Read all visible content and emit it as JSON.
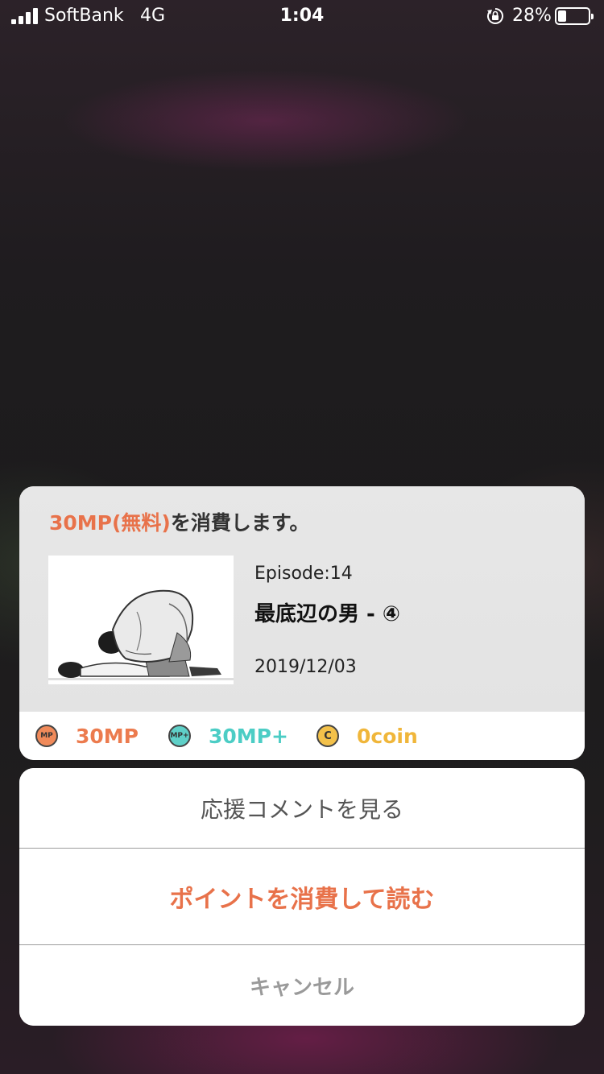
{
  "status_bar": {
    "carrier": "SoftBank",
    "network": "4G",
    "time": "1:04",
    "battery_percent": "28%",
    "battery_level": 0.28,
    "icons": [
      "signal-icon",
      "rotation-lock-icon",
      "battery-icon"
    ]
  },
  "dialog": {
    "consume_amount": "30MP(無料)",
    "consume_suffix": "を消費します。",
    "episode_number": "Episode:14",
    "episode_title": "最底辺の男 - ④",
    "episode_date": "2019/12/03",
    "thumbnail_icon": "manga-panel-image"
  },
  "points": {
    "mp": {
      "icon_text": "MP",
      "label": "30MP",
      "color": "#ec7b4e"
    },
    "mp_plus": {
      "icon_text": "MP+",
      "label": "30MP+",
      "color": "#4ccdc5"
    },
    "coin": {
      "icon_text": "C",
      "label": "0coin",
      "color": "#f0b63a"
    }
  },
  "actions": {
    "view_comments": "応援コメントを見る",
    "read_with_points": "ポイントを消費して読む",
    "cancel": "キャンセル"
  },
  "colors": {
    "accent": "#e8724a",
    "cancel_text": "#9a9a9a"
  }
}
